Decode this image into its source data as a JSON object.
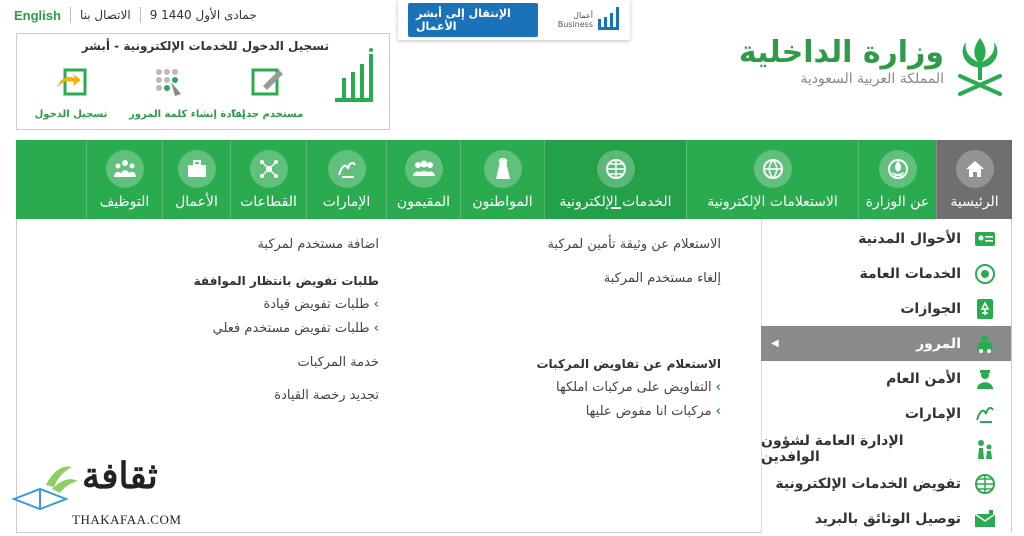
{
  "topbar": {
    "english": "English",
    "contact": "الاتصال بنا",
    "date": "9 جمادى الأول 1440"
  },
  "absher_business": {
    "button": "الإنتقال إلى أبشر الأعمال",
    "logo_ar": "أعمال",
    "logo_en": "Business"
  },
  "login": {
    "title": "تسجيل الدخول للخدمات الإلكترونية - أبشر",
    "actions": [
      {
        "label": "مستخدم جديد؟",
        "icon": "new-user-icon"
      },
      {
        "label": "إعادة إنشاء كلمة المرور",
        "icon": "reset-password-icon"
      },
      {
        "label": "تسجيل الدخول",
        "icon": "login-icon"
      }
    ]
  },
  "brand": {
    "title": "وزارة الداخلية",
    "subtitle": "المملكة العربية السعودية"
  },
  "nav": [
    {
      "label": "الرئيسية",
      "icon": "home-icon"
    },
    {
      "label": "عن الوزارة",
      "icon": "ministry-emblem-icon"
    },
    {
      "label": "الاستعلامات الإلكترونية",
      "icon": "globe-inquiry-icon"
    },
    {
      "label": "الخدمات الإلكترونية",
      "icon": "globe-icon"
    },
    {
      "label": "المواطنون",
      "icon": "citizen-icon"
    },
    {
      "label": "المقيمون",
      "icon": "residents-icon"
    },
    {
      "label": "الإمارات",
      "icon": "emirates-icon"
    },
    {
      "label": "القطاعات",
      "icon": "sectors-icon"
    },
    {
      "label": "الأعمال",
      "icon": "briefcase-icon"
    },
    {
      "label": "التوظيف",
      "icon": "employment-icon"
    }
  ],
  "side_menu": [
    {
      "label": "الأحوال المدنية",
      "icon": "id-card-icon"
    },
    {
      "label": "الخدمات العامة",
      "icon": "public-services-icon"
    },
    {
      "label": "الجوازات",
      "icon": "passport-icon"
    },
    {
      "label": "المرور",
      "icon": "traffic-icon",
      "active": true
    },
    {
      "label": "الأمن العام",
      "icon": "police-icon"
    },
    {
      "label": "الإمارات",
      "icon": "emirates-icon"
    },
    {
      "label": "الإدارة العامة لشؤون الوافدين",
      "icon": "expatriates-icon"
    },
    {
      "label": "تفويض الخدمات الإلكترونية",
      "icon": "globe-icon"
    },
    {
      "label": "توصيل الوثائق بالبريد",
      "icon": "mail-icon"
    }
  ],
  "content": {
    "col_right": {
      "insurance": "الاستعلام عن وثيقة تأمين لمركبة",
      "cancel_user": "إلغاء مستخدم المركبة",
      "auth_heading": "الاستعلام عن تفاويض المركبات",
      "auth_owned": "التفاويض على مركبات املكها",
      "auth_delegated": "مركبات انا مفوض عليها"
    },
    "col_left": {
      "add_user": "اضافة مستخدم لمركبة",
      "pending_heading": "طلبات تفويض بانتظار الموافقة",
      "pending_drive": "طلبات تفويض قيادة",
      "pending_actual": "طلبات تفويض مستخدم فعلي",
      "vehicle_service": "خدمة المركبات",
      "renew_license": "تجديد رخصة القيادة"
    }
  },
  "watermark": {
    "ar": "ثقافة",
    "en": "THAKAFAA.COM"
  },
  "colors": {
    "green": "#2bab50",
    "active_gray": "#6f6f6f",
    "blue": "#1a73b8"
  }
}
